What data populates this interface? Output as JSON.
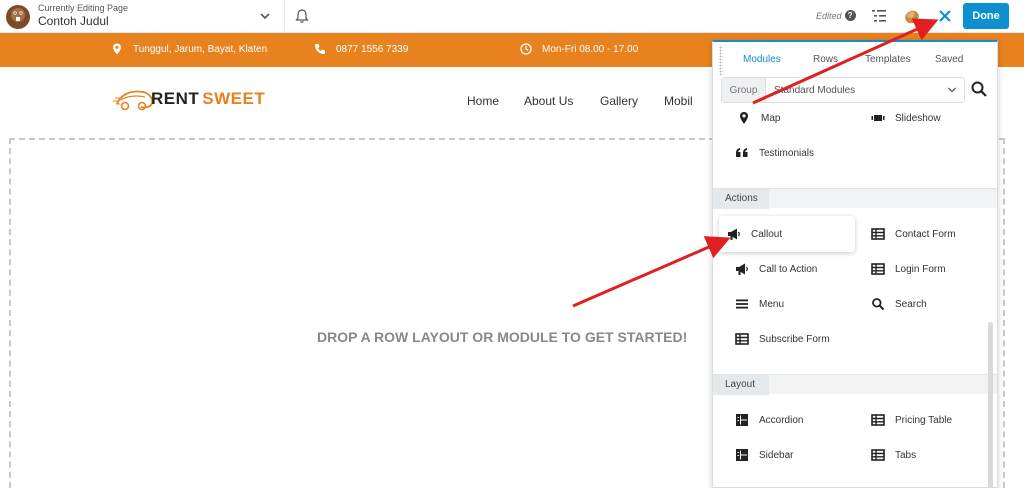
{
  "builder": {
    "editing_label": "Currently Editing Page",
    "page_title": "Contoh Judul",
    "edited_label": "Edited",
    "done_label": "Done"
  },
  "info_bar": {
    "address": "Tunggul, Jarum, Bayat, Klaten",
    "phone": "0877 1556 7339",
    "hours": "Mon-Fri 08.00 - 17.00"
  },
  "site": {
    "brand_rent": "RENT",
    "brand_sweet": "SWEET",
    "nav": [
      "Home",
      "About Us",
      "Gallery",
      "Mobil"
    ]
  },
  "canvas": {
    "drop_text": "DROP A ROW LAYOUT OR MODULE TO GET STARTED!"
  },
  "panel": {
    "tabs": [
      "Modules",
      "Rows",
      "Templates",
      "Saved"
    ],
    "active_tab": "Modules",
    "group_label": "Group",
    "group_value": "Standard Modules",
    "top_modules": [
      {
        "label": "Map",
        "icon": "map-pin-icon"
      },
      {
        "label": "Slideshow",
        "icon": "slideshow-icon"
      },
      {
        "label": "Testimonials",
        "icon": "quote-icon"
      }
    ],
    "sections": [
      {
        "title": "Actions",
        "modules": [
          {
            "label": "Callout",
            "icon": "megaphone-icon"
          },
          {
            "label": "Contact Form",
            "icon": "table-icon"
          },
          {
            "label": "Call to Action",
            "icon": "megaphone-icon"
          },
          {
            "label": "Login Form",
            "icon": "table-icon"
          },
          {
            "label": "Menu",
            "icon": "menu-icon"
          },
          {
            "label": "Search",
            "icon": "search-icon"
          },
          {
            "label": "Subscribe Form",
            "icon": "table-icon"
          }
        ]
      },
      {
        "title": "Layout",
        "modules": [
          {
            "label": "Accordion",
            "icon": "layout-icon"
          },
          {
            "label": "Pricing Table",
            "icon": "table-icon"
          },
          {
            "label": "Sidebar",
            "icon": "layout-icon"
          },
          {
            "label": "Tabs",
            "icon": "table-icon"
          }
        ]
      }
    ]
  },
  "colors": {
    "accent_blue": "#0e8fd0",
    "orange": "#e8821f",
    "arrow_red": "#e02020"
  }
}
